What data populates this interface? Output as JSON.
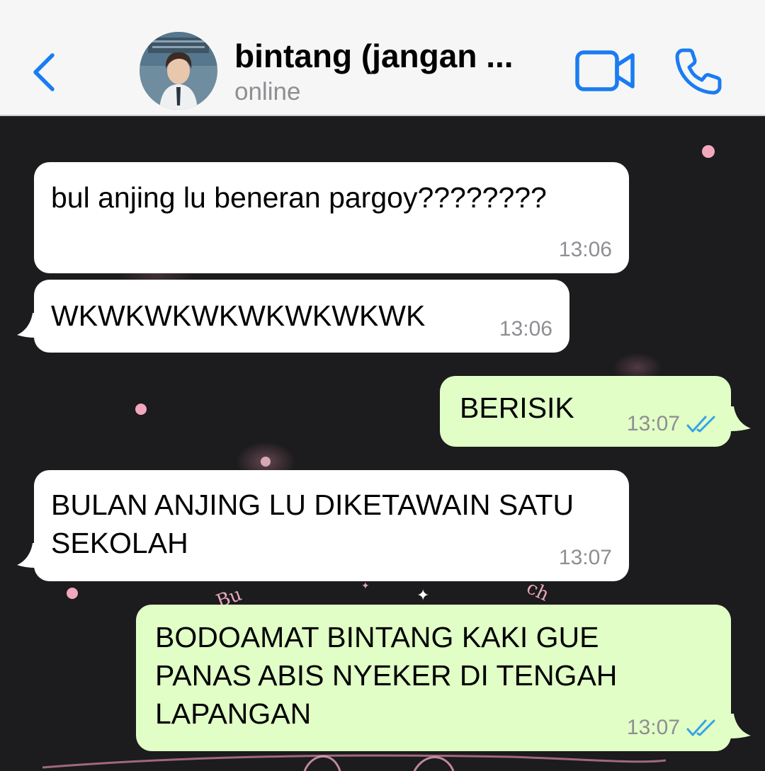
{
  "header": {
    "contact_name": "bintang (jangan ...",
    "status": "online",
    "icons": {
      "back": "chevron-left-icon",
      "video": "video-camera-icon",
      "phone": "phone-icon"
    },
    "accent_color": "#1a7cf2"
  },
  "messages": [
    {
      "direction": "incoming",
      "text": "bul anjing lu beneran pargoy????????",
      "time": "13:06"
    },
    {
      "direction": "incoming",
      "text": "WKWKWKWKWKWKWKWK",
      "time": "13:06"
    },
    {
      "direction": "outgoing",
      "text": "BERISIK",
      "time": "13:07",
      "read": true
    },
    {
      "direction": "incoming",
      "text": "BULAN ANJING LU DIKETAWAIN SATU\nSEKOLAH",
      "time": "13:07"
    },
    {
      "direction": "outgoing",
      "text": "BODOAMAT BINTANG KAKI GUE\nPANAS ABIS NYEKER DI TENGAH\nLAPANGAN",
      "time": "13:07",
      "read": true
    }
  ],
  "colors": {
    "incoming_bubble": "#ffffff",
    "outgoing_bubble": "#e1fec6",
    "read_ticks": "#35a3e6",
    "wallpaper": "#1c1b1d"
  }
}
